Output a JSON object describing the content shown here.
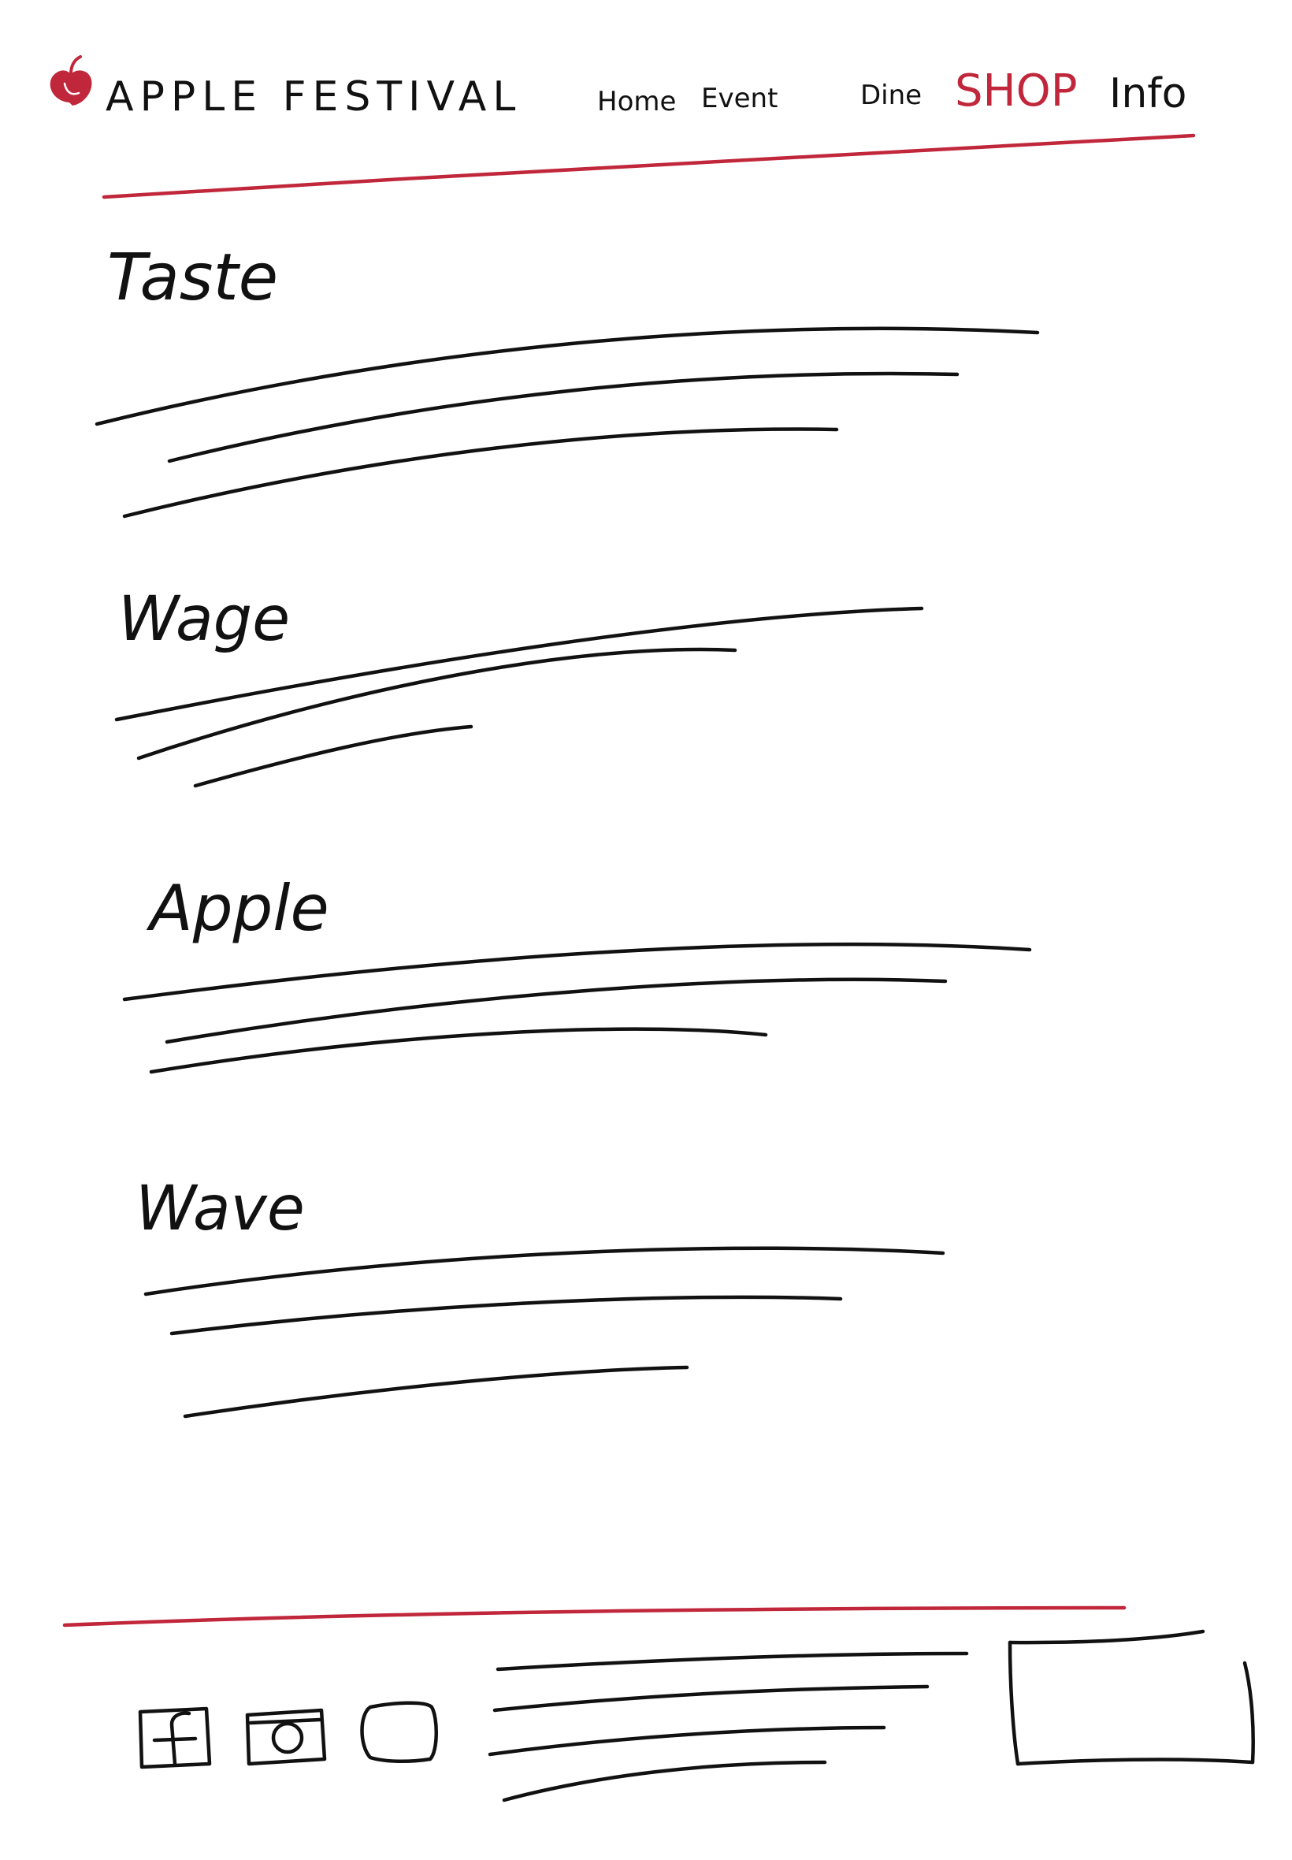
{
  "header": {
    "brand": "APPLE FESTIVAL",
    "nav": [
      {
        "label": "Home"
      },
      {
        "label": "Event"
      },
      {
        "label": "Dine"
      },
      {
        "label": "SHOP",
        "active": true
      },
      {
        "label": "Info"
      }
    ]
  },
  "sections": [
    {
      "heading": "Taste"
    },
    {
      "heading": "Wage"
    },
    {
      "heading": "Apple"
    },
    {
      "heading": "Wave"
    }
  ],
  "footer": {
    "social_icons": [
      "facebook-icon",
      "instagram-icon",
      "chat-icon"
    ]
  },
  "colors": {
    "accent": "#c1273b",
    "ink": "#111111",
    "background": "#ffffff"
  }
}
